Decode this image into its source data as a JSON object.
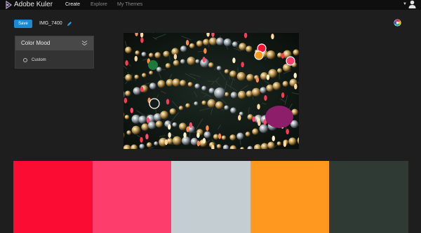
{
  "app": {
    "brand": "Adobe Kuler"
  },
  "nav": {
    "create": "Create",
    "explore": "Explore",
    "my_themes": "My Themes"
  },
  "toolbar": {
    "save_label": "Save",
    "theme_name": "IMG_7400"
  },
  "mood_panel": {
    "title": "Color Mood",
    "option": "Custom"
  },
  "photo": {
    "picker_colors": [
      "#fa1234",
      "#fe981d",
      "#ff3f6e"
    ]
  },
  "swatches": [
    "#fb0d33",
    "#fd3e6d",
    "#c4cdd2",
    "#fe981f",
    "#2e3a33"
  ],
  "colors": {
    "accent": "#1a8ad6",
    "topbar": "#0f0f0f",
    "background": "#1e1e1e"
  },
  "icons": [
    "kuler-logo-icon",
    "pencil-icon",
    "color-wheel-icon",
    "user-icon",
    "chevron-down-icon"
  ]
}
